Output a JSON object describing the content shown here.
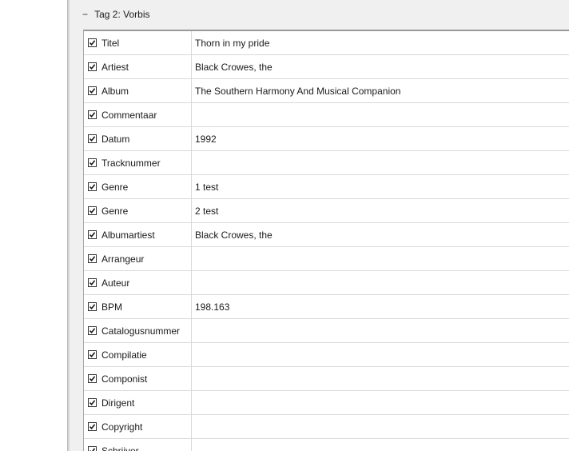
{
  "group": {
    "toggle": "−",
    "title": "Tag 2: Vorbis"
  },
  "rows": [
    {
      "name": "Titel",
      "value": "Thorn in my pride",
      "checked": true
    },
    {
      "name": "Artiest",
      "value": "Black Crowes, the",
      "checked": true
    },
    {
      "name": "Album",
      "value": "The Southern Harmony And Musical Companion",
      "checked": true
    },
    {
      "name": "Commentaar",
      "value": "",
      "checked": true
    },
    {
      "name": "Datum",
      "value": "1992",
      "checked": true
    },
    {
      "name": "Tracknummer",
      "value": "",
      "checked": true
    },
    {
      "name": "Genre",
      "value": "1 test",
      "checked": true
    },
    {
      "name": "Genre",
      "value": "2 test",
      "checked": true
    },
    {
      "name": "Albumartiest",
      "value": "Black Crowes, the",
      "checked": true
    },
    {
      "name": "Arrangeur",
      "value": "",
      "checked": true
    },
    {
      "name": "Auteur",
      "value": "",
      "checked": true
    },
    {
      "name": "BPM",
      "value": "198.163",
      "checked": true
    },
    {
      "name": "Catalogusnummer",
      "value": "",
      "checked": true
    },
    {
      "name": "Compilatie",
      "value": "",
      "checked": true
    },
    {
      "name": "Componist",
      "value": "",
      "checked": true
    },
    {
      "name": "Dirigent",
      "value": "",
      "checked": true
    },
    {
      "name": "Copyright",
      "value": "",
      "checked": true
    },
    {
      "name": "Schrijver",
      "value": "",
      "checked": true
    }
  ]
}
